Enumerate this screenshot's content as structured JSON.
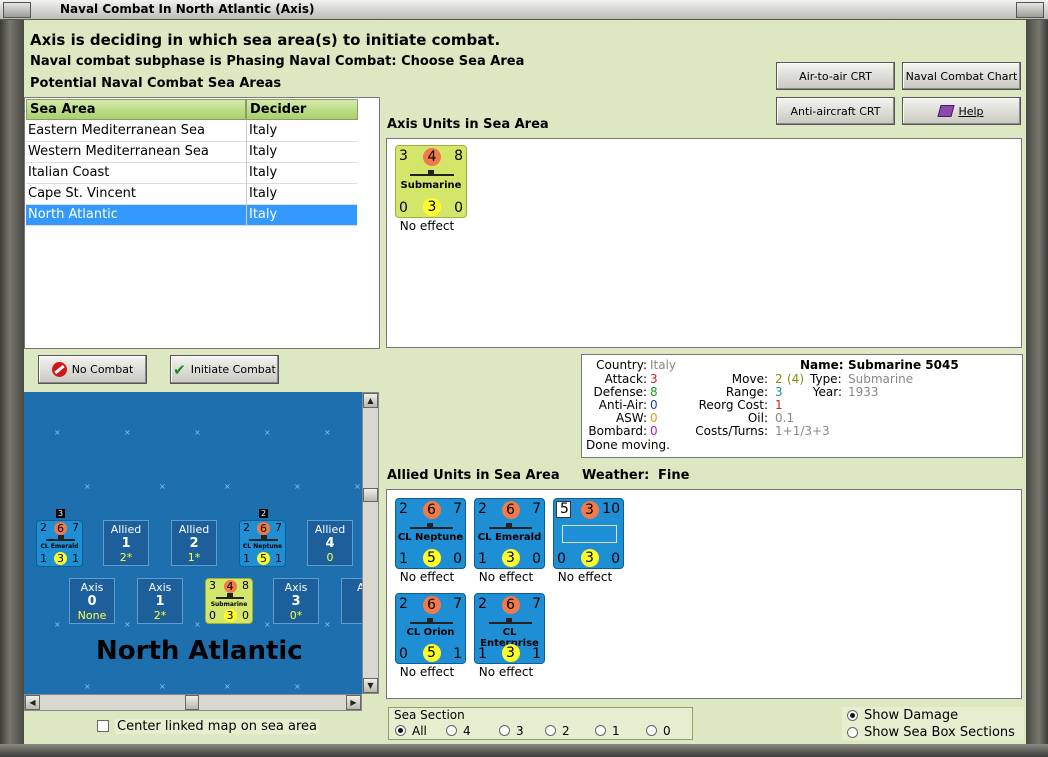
{
  "window": {
    "title": "Naval Combat In North Atlantic (Axis)"
  },
  "header": {
    "line1": "Axis is deciding in which sea area(s) to initiate combat.",
    "line2": "Naval combat subphase is Phasing Naval Combat: Choose Sea Area",
    "line3": "Potential Naval Combat Sea Areas"
  },
  "sea_list": {
    "col_area": "Sea Area",
    "col_decider": "Decider",
    "rows": [
      {
        "area": "Eastern Mediterranean Sea",
        "decider": "Italy"
      },
      {
        "area": "Western Mediterranean Sea",
        "decider": "Italy"
      },
      {
        "area": "Italian Coast",
        "decider": "Italy"
      },
      {
        "area": "Cape St. Vincent",
        "decider": "Italy"
      },
      {
        "area": "North Atlantic",
        "decider": "Italy"
      }
    ],
    "selected_index": 4
  },
  "buttons": {
    "air_to_air": "Air-to-air CRT",
    "naval_chart": "Naval Combat Chart",
    "anti_aircraft": "Anti-aircraft CRT",
    "help": "Help",
    "no_combat": "No Combat",
    "initiate": "Initiate Combat"
  },
  "axis_panel": {
    "title": "Axis Units in Sea Area",
    "units": [
      {
        "name": "Submarine",
        "tl": "3",
        "tc": "4",
        "tr": "8",
        "bl": "0",
        "bc": "3",
        "br": "0",
        "effect": "No effect"
      }
    ]
  },
  "details": {
    "country_label": "Country:",
    "country": "Italy",
    "attack_label": "Attack:",
    "attack": "3",
    "defense_label": "Defense:",
    "defense": "8",
    "antiair_label": "Anti-Air:",
    "antiair": "0",
    "asw_label": "ASW:",
    "asw": "0",
    "bombard_label": "Bombard:",
    "bombard": "0",
    "done": "Done moving.",
    "name_label": "Name:",
    "name": "Submarine 5045",
    "move_label": "Move:",
    "move": "2",
    "move_extra": "(4)",
    "type_label": "Type:",
    "type": "Submarine",
    "range_label": "Range:",
    "range": "3",
    "year_label": "Year:",
    "year": "1933",
    "reorg_label": "Reorg Cost:",
    "reorg": "1",
    "oil_label": "Oil:",
    "oil": "0.1",
    "costs_label": "Costs/Turns:",
    "costs": "1+1/3+3"
  },
  "allied_panel": {
    "title": "Allied Units in Sea Area",
    "weather_label": "Weather:",
    "weather": "Fine",
    "units": [
      {
        "name": "CL Neptune",
        "tl": "2",
        "tc": "6",
        "tr": "7",
        "bl": "1",
        "bc": "5",
        "br": "0",
        "effect": "No effect"
      },
      {
        "name": "CL Emerald",
        "tl": "2",
        "tc": "6",
        "tr": "7",
        "bl": "1",
        "bc": "3",
        "br": "0",
        "effect": "No effect"
      },
      {
        "name": "",
        "tl": "5",
        "tc": "3",
        "tr": "10",
        "bl": "0",
        "bc": "3",
        "br": "0",
        "effect": "No effect"
      },
      {
        "name": "CL Orion",
        "tl": "2",
        "tc": "6",
        "tr": "7",
        "bl": "0",
        "bc": "5",
        "br": "1",
        "effect": "No effect"
      },
      {
        "name": "CL Enterprise",
        "tl": "2",
        "tc": "6",
        "tr": "7",
        "bl": "1",
        "bc": "3",
        "br": "1",
        "effect": "No effect"
      }
    ]
  },
  "map": {
    "name": "North Atlantic",
    "badges": [
      "3",
      "2"
    ],
    "counter_emerald": {
      "name": "CL Emerald",
      "tl": "2",
      "tc": "6",
      "tr": "7",
      "bl": "1",
      "bc": "3",
      "br": "1"
    },
    "counter_neptune": {
      "name": "CL Neptune",
      "tl": "2",
      "tc": "6",
      "tr": "7",
      "bl": "1",
      "bc": "5",
      "br": "1"
    },
    "counter_sub": {
      "name": "Submarine",
      "tl": "3",
      "tc": "4",
      "tr": "8",
      "bl": "0",
      "bc": "3",
      "br": "0"
    },
    "allied_boxes": [
      {
        "side": "Allied",
        "num": "1",
        "val": "2*"
      },
      {
        "side": "Allied",
        "num": "2",
        "val": "1*"
      },
      {
        "side": "Allied",
        "num": "4",
        "val": "0"
      }
    ],
    "axis_boxes": [
      {
        "side": "Axis",
        "num": "0",
        "val": "None"
      },
      {
        "side": "Axis",
        "num": "1",
        "val": "2*"
      },
      {
        "side": "Axis",
        "num": "3",
        "val": "0*"
      },
      {
        "side": "Ax",
        "num": "",
        "val": ""
      }
    ]
  },
  "center_map_label": "Center linked map on sea area",
  "sea_section": {
    "label": "Sea Section",
    "options": [
      "All",
      "4",
      "3",
      "2",
      "1",
      "0"
    ],
    "selected": "All"
  },
  "show_damage": "Show Damage",
  "show_sections": "Show Sea Box Sections",
  "colors": {
    "background": "#dde7c2",
    "selection": "#3399ff",
    "allied_counter": "#1e8fd5",
    "axis_counter": "#d4e66a",
    "map_sea": "#1e6fae"
  }
}
